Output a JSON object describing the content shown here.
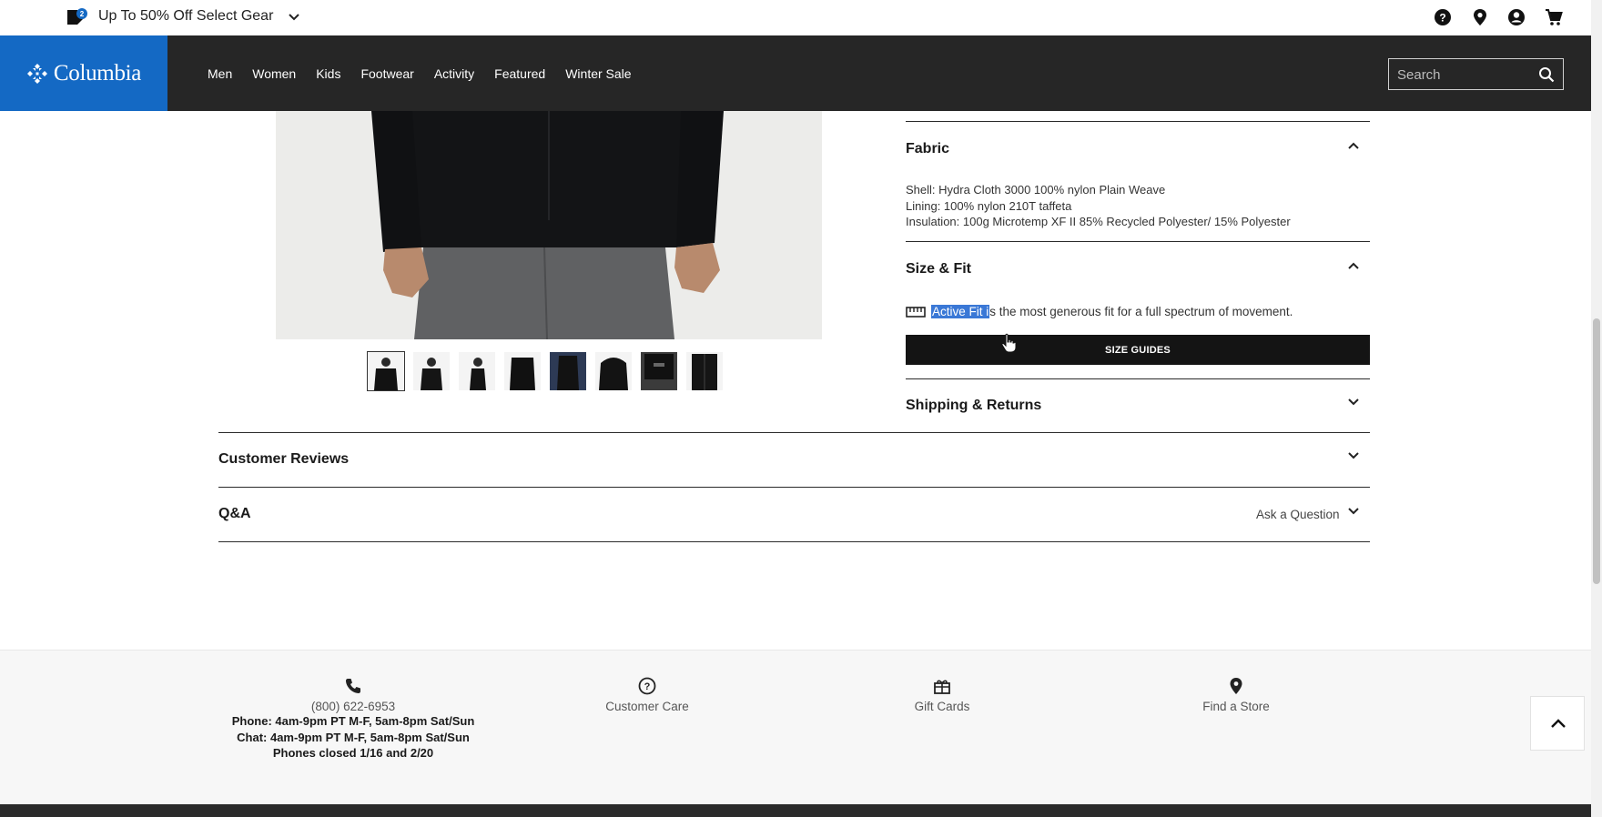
{
  "promo": {
    "text": "Up To 50% Off Select Gear",
    "badge_count": "2"
  },
  "brand": {
    "name": "Columbia",
    "primary_color": "#1469c4",
    "header_color": "#262626"
  },
  "nav": {
    "items": [
      "Men",
      "Women",
      "Kids",
      "Footwear",
      "Activity",
      "Featured",
      "Winter Sale"
    ]
  },
  "search": {
    "placeholder": "Search"
  },
  "utility_icons": [
    "help-icon",
    "location-icon",
    "account-icon",
    "cart-icon"
  ],
  "product": {
    "thumbnail_count": 8,
    "active_thumbnail": 1
  },
  "accordions": {
    "fabric": {
      "title": "Fabric",
      "lines": [
        "Shell: Hydra Cloth 3000 100% nylon Plain Weave",
        "Lining: 100% nylon 210T taffeta",
        "Insulation: 100g Microtemp XF II 85% Recycled Polyester/ 15% Polyester"
      ]
    },
    "size_fit": {
      "title": "Size & Fit",
      "fit_highlight": "Active Fit i",
      "fit_rest": "s the most generous fit for a full spectrum of movement.",
      "button": "SIZE GUIDES"
    },
    "shipping": {
      "title": "Shipping & Returns"
    },
    "reviews": {
      "title": "Customer Reviews"
    },
    "qa": {
      "title": "Q&A",
      "action": "Ask a Question"
    }
  },
  "footer": {
    "phone": {
      "number": "(800) 622-6953",
      "hours_phone": "Phone: 4am-9pm PT M-F, 5am-8pm Sat/Sun",
      "hours_chat": "Chat: 4am-9pm PT M-F, 5am-8pm Sat/Sun",
      "closed": "Phones closed 1/16 and 2/20"
    },
    "customer_care": "Customer Care",
    "gift_cards": "Gift Cards",
    "find_store": "Find a Store"
  }
}
